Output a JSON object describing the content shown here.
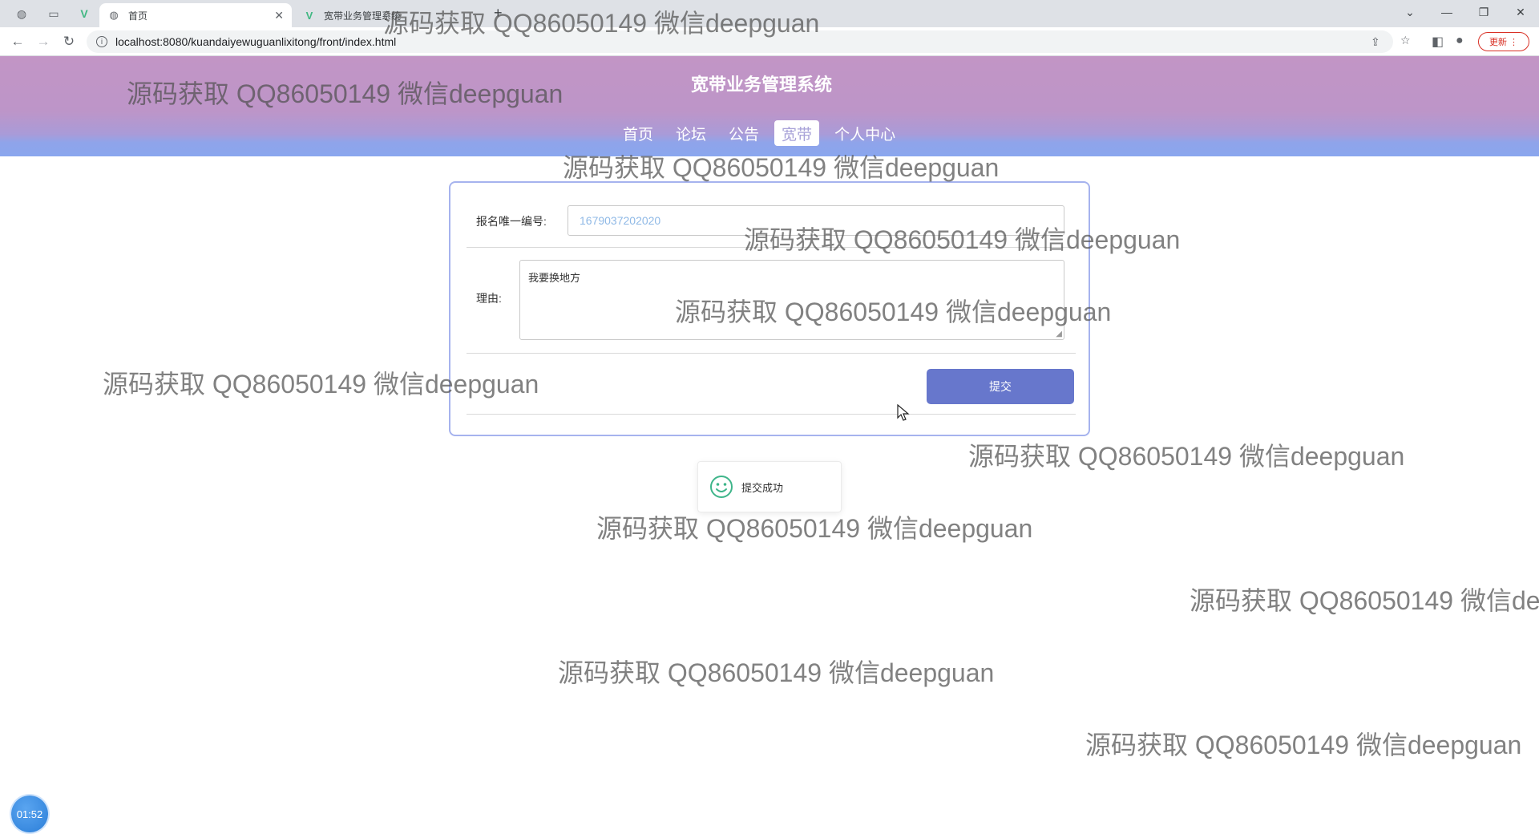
{
  "browser": {
    "tabs": [
      {
        "title": "首页",
        "active": true
      },
      {
        "title": "宽带业务管理系统",
        "active": false
      }
    ],
    "url": "localhost:8080/kuandaiyewuguanlixitong/front/index.html",
    "update_label": "更新"
  },
  "site": {
    "title": "宽带业务管理系统",
    "nav": [
      {
        "label": "首页",
        "active": false
      },
      {
        "label": "论坛",
        "active": false
      },
      {
        "label": "公告",
        "active": false
      },
      {
        "label": "宽带",
        "active": true
      },
      {
        "label": "个人中心",
        "active": false
      }
    ]
  },
  "form": {
    "serial_label": "报名唯一编号:",
    "serial_value": "1679037202020",
    "reason_label": "理由:",
    "reason_value": "我要换地方",
    "submit_label": "提交"
  },
  "toast": {
    "message": "提交成功"
  },
  "timer": {
    "value": "01:52"
  },
  "watermark": "源码获取 QQ86050149 微信deepguan",
  "colors": {
    "header_top": "#c295c5",
    "header_bottom": "#8aa6ee",
    "submit_button": "#6777cc",
    "card_border": "#a6b3ee",
    "toast_icon": "#3fb58a"
  }
}
